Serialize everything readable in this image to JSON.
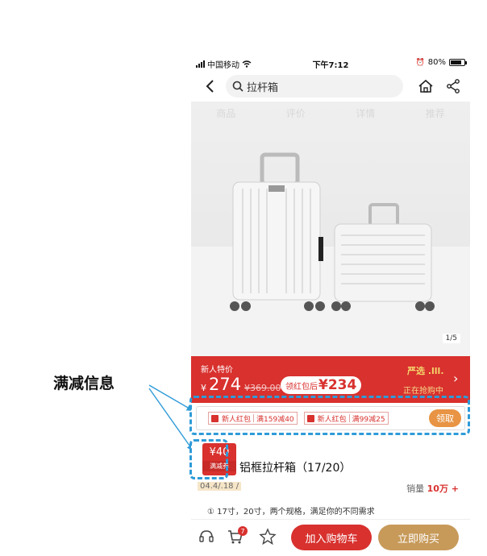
{
  "annotation": {
    "label": "满减信息"
  },
  "status_bar": {
    "carrier": "中国移动",
    "time": "下午7:12",
    "battery": "80%",
    "battery_level": 0.8
  },
  "nav": {
    "search_text": "拉杆箱"
  },
  "gallery": {
    "tabs": [
      "商品",
      "评价",
      "详情",
      "推荐"
    ],
    "page_indicator": "1/5"
  },
  "price": {
    "label": "新人特价",
    "currency": "¥",
    "current": "274",
    "original": "¥369.00",
    "after_coupon_label": "领红包后",
    "after_coupon_price": "¥234",
    "brand_tag": "严选 .lll.",
    "status": "正在抢购中"
  },
  "coupons": {
    "items": [
      {
        "name": "新人红包",
        "rule": "满159减40"
      },
      {
        "name": "新人红包",
        "rule": "满99减25"
      }
    ],
    "get_button": "领取"
  },
  "coupon_card": {
    "amount": "¥40",
    "label": "满减券"
  },
  "product": {
    "title": "铝框拉杆箱（17/20）",
    "date": "04.4/.18 /",
    "sales_label": "销量",
    "sales_value": "10万 +",
    "spec": "① 17寸，20寸，两个规格，满足你的不同需求"
  },
  "bottom_bar": {
    "cart_count": "7",
    "add_to_cart": "加入购物车",
    "buy_now": "立即购买"
  },
  "colors": {
    "accent_red": "#d8312e",
    "gold": "#c79a5a",
    "annotation_blue": "#2f9bd8"
  }
}
